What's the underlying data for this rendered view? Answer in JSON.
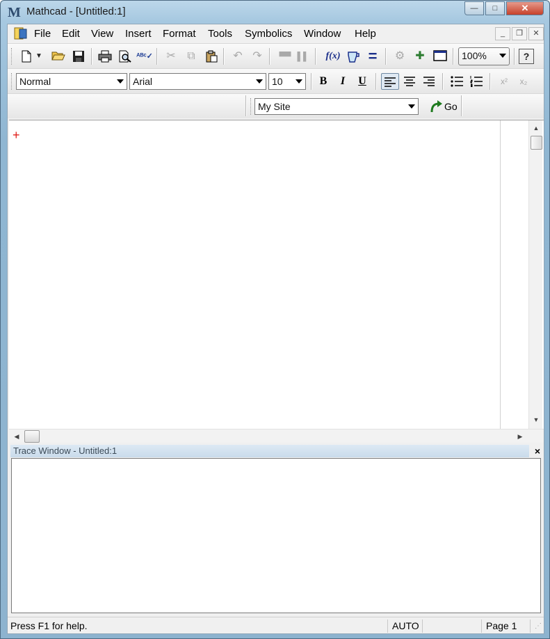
{
  "window": {
    "title": "Mathcad - [Untitled:1]",
    "logo_letter": "M",
    "minimize": "—",
    "maximize": "□",
    "close": "✕"
  },
  "menu": {
    "items": [
      "File",
      "Edit",
      "View",
      "Insert",
      "Format",
      "Tools",
      "Symbolics",
      "Window",
      "Help"
    ],
    "mdi_minimize": "_",
    "mdi_restore": "❐",
    "mdi_close": "✕"
  },
  "toolbar_standard": {
    "zoom_value": "100%",
    "help_label": "?",
    "math_label": "f(x)",
    "equals_label": "="
  },
  "toolbar_formatting": {
    "style_value": "Normal",
    "font_value": "Arial",
    "size_value": "10",
    "bold": "B",
    "italic": "I",
    "underline": "U",
    "superscript": "x²",
    "subscript": "x₂"
  },
  "toolbar_resources": {
    "site_value": "My Site",
    "go_label": "Go"
  },
  "document": {
    "cursor_glyph": "+"
  },
  "trace": {
    "title": "Trace Window - Untitled:1",
    "close": "×"
  },
  "status": {
    "help": "Press F1 for help.",
    "mode": "AUTO",
    "page": "Page 1"
  },
  "colors": {
    "cursor": "#e0201b",
    "title_bar": "#a6c8e0",
    "close_button": "#c6412a"
  }
}
